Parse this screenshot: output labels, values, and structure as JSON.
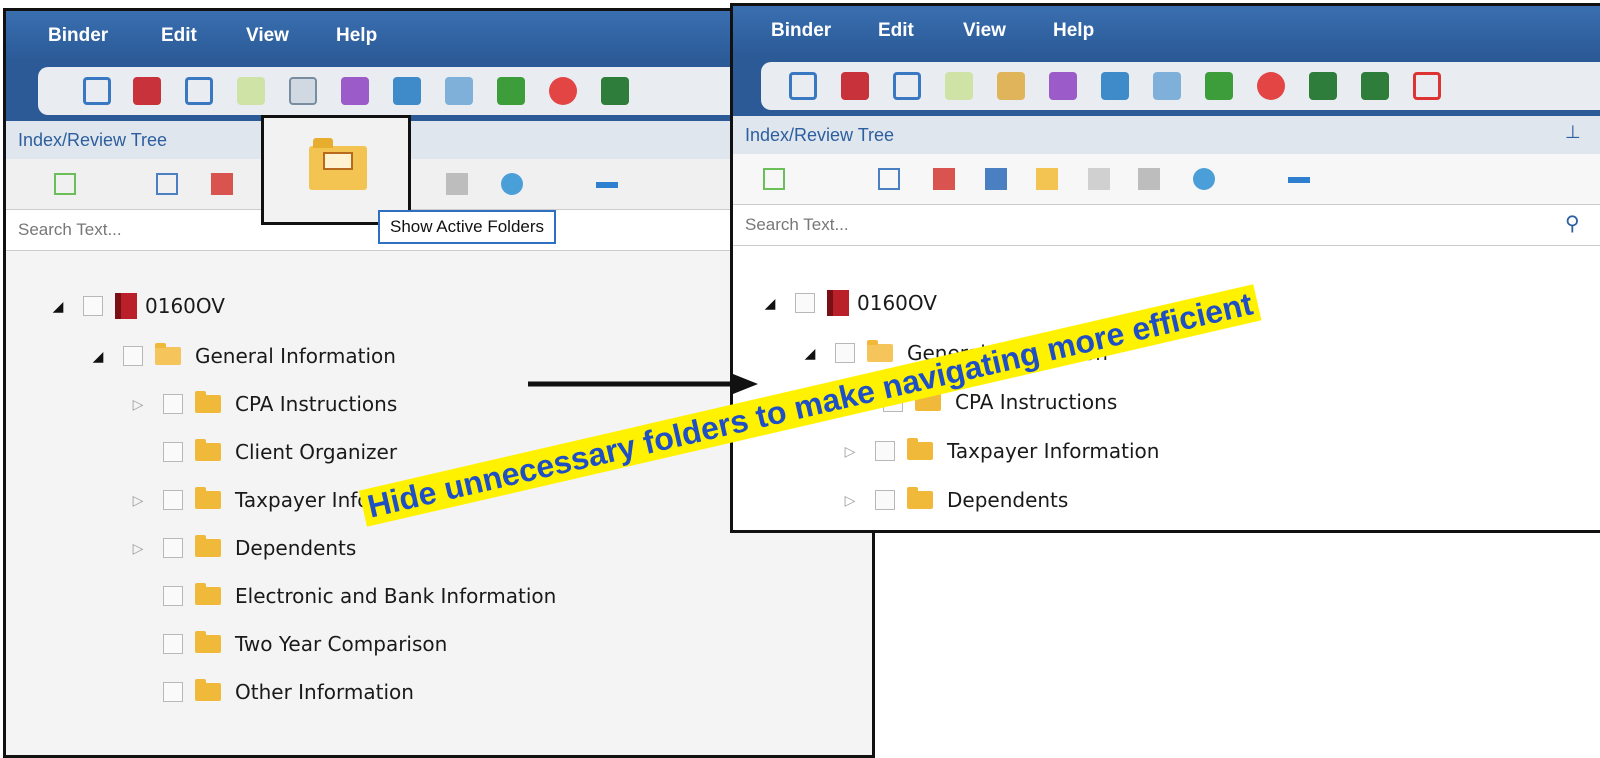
{
  "menu": [
    "Binder",
    "Edit",
    "View",
    "Help"
  ],
  "left_panel": {
    "tree_title": "Index/Review Tree",
    "search_placeholder": "Search Text...",
    "tooltip": "Show Active Folders",
    "binder_name": "0160OV",
    "root_folder": "General Information",
    "items": [
      {
        "label": "CPA Instructions",
        "expandable": true
      },
      {
        "label": "Client Organizer",
        "expandable": false
      },
      {
        "label": "Taxpayer Information",
        "expandable": true
      },
      {
        "label": "Dependents",
        "expandable": true
      },
      {
        "label": "Electronic and Bank Information",
        "expandable": false
      },
      {
        "label": "Two Year Comparison",
        "expandable": false
      },
      {
        "label": "Other Information",
        "expandable": false
      }
    ]
  },
  "right_panel": {
    "tree_title": "Index/Review Tree",
    "search_placeholder": "Search Text...",
    "binder_name": "0160OV",
    "root_folder": "General Information",
    "items": [
      {
        "label": "CPA Instructions",
        "expandable": false
      },
      {
        "label": "Taxpayer Information",
        "expandable": true
      },
      {
        "label": "Dependents",
        "expandable": true
      }
    ]
  },
  "banner_text": "Hide unnecessary folders to make navigating more efficient",
  "colors": {
    "menubar": "#2b5a97",
    "banner_bg": "#fff200",
    "banner_text": "#1f4fc4",
    "folder": "#f0b93a"
  },
  "icons": [
    "save-icon",
    "pdf-export-icon",
    "print-icon",
    "document-icon",
    "clipboard-icon",
    "monitor-icon",
    "network-icon",
    "sort-icon",
    "user-stamp-icon",
    "no-entry-icon",
    "tei-icon",
    "tax-icon",
    "calendar-icon"
  ]
}
